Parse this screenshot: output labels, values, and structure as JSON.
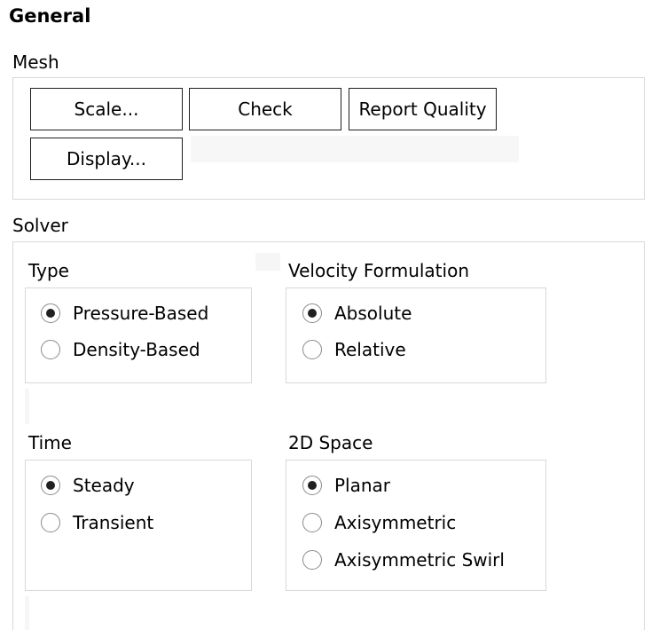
{
  "panel": {
    "title": "General"
  },
  "mesh": {
    "label": "Mesh",
    "buttons": {
      "scale": "Scale...",
      "check": "Check",
      "report_quality": "Report Quality",
      "display": "Display..."
    }
  },
  "solver": {
    "label": "Solver",
    "type": {
      "label": "Type",
      "options": [
        "Pressure-Based",
        "Density-Based"
      ],
      "selected": "Pressure-Based"
    },
    "velocity_formulation": {
      "label": "Velocity Formulation",
      "options": [
        "Absolute",
        "Relative"
      ],
      "selected": "Absolute"
    },
    "time": {
      "label": "Time",
      "options": [
        "Steady",
        "Transient"
      ],
      "selected": "Steady"
    },
    "space_2d": {
      "label": "2D Space",
      "options": [
        "Planar",
        "Axisymmetric",
        "Axisymmetric Swirl"
      ],
      "selected": "Planar"
    }
  }
}
